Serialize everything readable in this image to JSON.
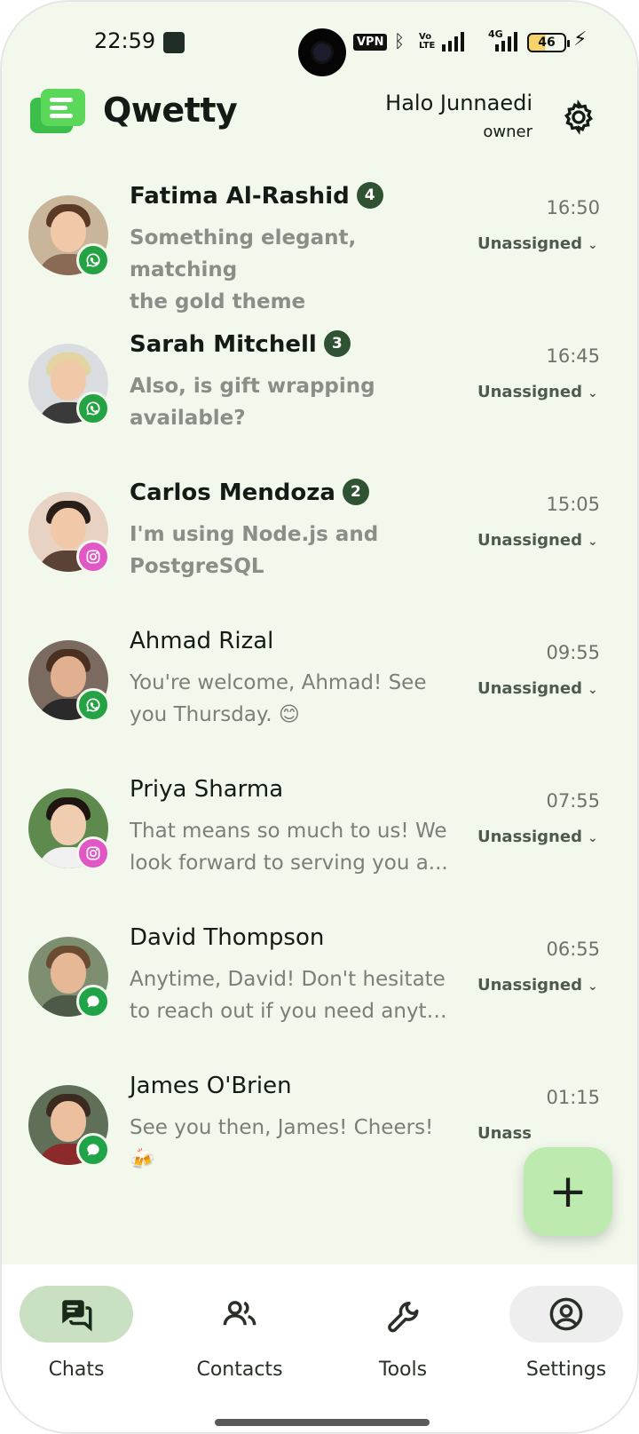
{
  "status_bar": {
    "time": "22:59",
    "vpn": "VPN",
    "network": "4G",
    "battery": "46"
  },
  "header": {
    "app_name": "Qwetty",
    "user_name": "Halo Junnaedi",
    "user_role": "owner"
  },
  "chats": [
    {
      "name": "Fatima Al-Rashid",
      "unread": "4",
      "line1": "Something elegant, matching",
      "line2": "the gold theme",
      "time": "16:50",
      "assignee": "Unassigned",
      "channel": "whatsapp",
      "bold": true
    },
    {
      "name": "Sarah Mitchell",
      "unread": "3",
      "line1": "Also, is gift wrapping",
      "line2": "available?",
      "time": "16:45",
      "assignee": "Unassigned",
      "channel": "whatsapp",
      "bold": true
    },
    {
      "name": "Carlos Mendoza",
      "unread": "2",
      "line1": "I'm using Node.js and",
      "line2": "PostgreSQL",
      "time": "15:05",
      "assignee": "Unassigned",
      "channel": "instagram",
      "bold": true
    },
    {
      "name": "Ahmad Rizal",
      "unread": "",
      "line1": "You're welcome, Ahmad! See",
      "line2": "you Thursday. 😊",
      "time": "09:55",
      "assignee": "Unassigned",
      "channel": "whatsapp",
      "bold": false
    },
    {
      "name": "Priya Sharma",
      "unread": "",
      "line1": "That means so much to us! We",
      "line2": "look forward to serving you a...",
      "time": "07:55",
      "assignee": "Unassigned",
      "channel": "instagram",
      "bold": false
    },
    {
      "name": "David Thompson",
      "unread": "",
      "line1": "Anytime, David! Don't hesitate",
      "line2": "to reach out if you need anyth...",
      "time": "06:55",
      "assignee": "Unassigned",
      "channel": "livechat",
      "bold": false
    },
    {
      "name": "James O'Brien",
      "unread": "",
      "line1": "See you then, James! Cheers!",
      "line2": "🍻",
      "time": "01:15",
      "assignee": "Unass",
      "channel": "livechat",
      "bold": false
    }
  ],
  "fab": {
    "label": "+"
  },
  "nav": {
    "chats": "Chats",
    "contacts": "Contacts",
    "tools": "Tools",
    "settings": "Settings"
  }
}
